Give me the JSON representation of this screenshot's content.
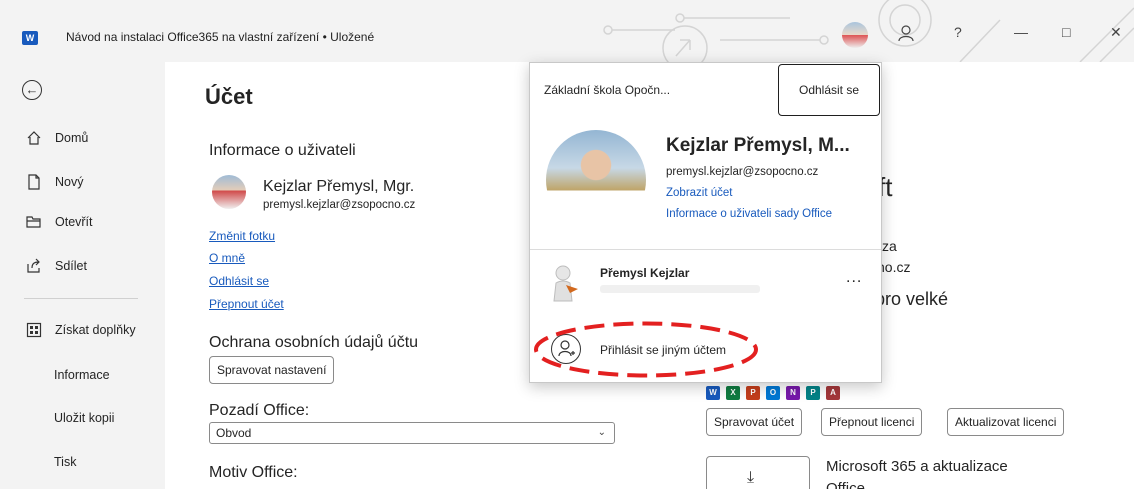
{
  "titlebar": {
    "app_icon": "word-icon",
    "app_letter": "W",
    "title": "Návod na instalaci Office365 na vlastní zařízení • Uložené",
    "help": "?",
    "minimize": "—",
    "maximize": "□",
    "close": "✕"
  },
  "nav": {
    "back_icon": "back-arrow-icon",
    "items": [
      {
        "label": "Domů",
        "icon": "home-icon"
      },
      {
        "label": "Nový",
        "icon": "new-document-icon"
      },
      {
        "label": "Otevřít",
        "icon": "folder-icon"
      },
      {
        "label": "Sdílet",
        "icon": "share-icon"
      },
      {
        "label": "Získat doplňky",
        "icon": "add-ins-icon"
      },
      {
        "label": "Informace"
      },
      {
        "label": "Uložit kopii"
      },
      {
        "label": "Tisk"
      }
    ]
  },
  "account": {
    "title": "Účet",
    "user_info_heading": "Informace o uživateli",
    "user_name": "Kejzlar Přemysl, Mgr.",
    "user_email": "premysl.kejzlar@zsopocno.cz",
    "links": [
      "Změnit fotku",
      "O mně",
      "Odhlásit se",
      "Přepnout účet"
    ],
    "privacy_heading": "Ochrana osobních údajů účtu",
    "privacy_button": "Spravovat nastavení",
    "background_heading": "Pozadí Office:",
    "background_value": "Obvod",
    "theme_heading": "Motiv Office:"
  },
  "product": {
    "frag_ft": "ft",
    "frag_za": "za",
    "frag_no": "no.cz",
    "frag_big": "pro velké",
    "apps": [
      {
        "letter": "W",
        "color": "#185abd"
      },
      {
        "letter": "X",
        "color": "#107c41"
      },
      {
        "letter": "P",
        "color": "#c43e1c"
      },
      {
        "letter": "O",
        "color": "#0078d4"
      },
      {
        "letter": "N",
        "color": "#7719aa"
      },
      {
        "letter": "P",
        "color": "#038387"
      },
      {
        "letter": "A",
        "color": "#a4373a"
      }
    ],
    "btn_manage": "Spravovat účet",
    "btn_switch_license": "Přepnout licenci",
    "btn_update_license": "Aktualizovat licenci",
    "updates_heading_line1": "Microsoft 365 a aktualizace",
    "updates_heading_line2": "Office"
  },
  "flyout": {
    "org": "Základní škola Opočn...",
    "signout": "Odhlásit se",
    "name": "Kejzlar Přemysl, M...",
    "email": "premysl.kejzlar@zsopocno.cz",
    "view_account": "Zobrazit účet",
    "office_user_info": "Informace o uživateli sady Office",
    "other_account_name": "Přemysl Kejzlar",
    "more": "...",
    "add_account": "Přihlásit se jiným účtem",
    "highlight_color": "#e32020"
  }
}
